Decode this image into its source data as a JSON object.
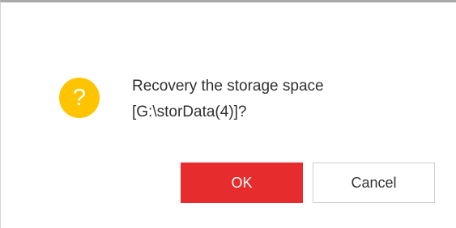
{
  "dialog": {
    "icon": "question-icon",
    "icon_glyph": "?",
    "icon_color": "#ffc400",
    "message_line1": "Recovery the storage space",
    "message_line2": "[G:\\storData(4)]?",
    "ok_label": "OK",
    "cancel_label": "Cancel",
    "ok_color": "#e62c2c"
  }
}
